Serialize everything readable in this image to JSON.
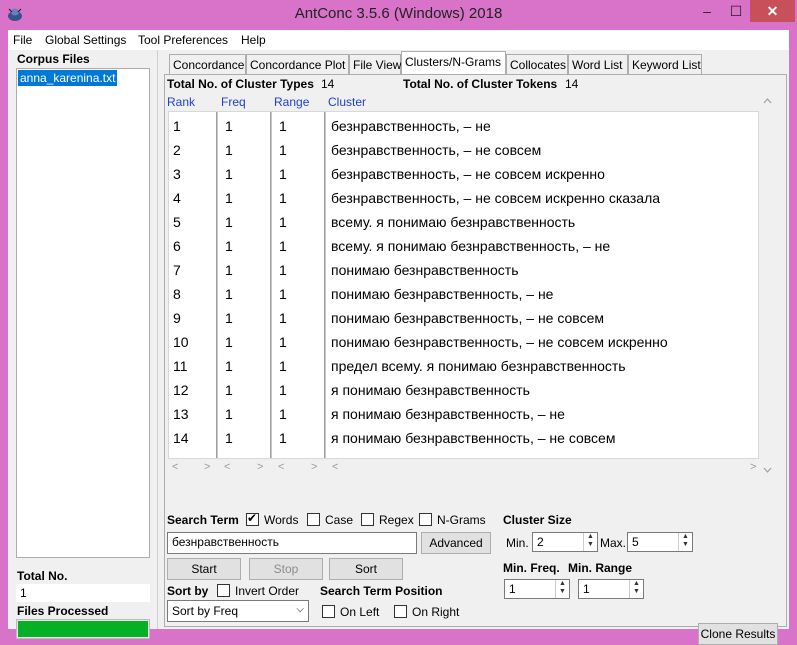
{
  "window": {
    "title": "AntConc 3.5.6 (Windows) 2018",
    "min": "–",
    "max": "☐",
    "close": "✕"
  },
  "menu": [
    "File",
    "Global Settings",
    "Tool Preferences",
    "Help"
  ],
  "left": {
    "corpus_files_label": "Corpus Files",
    "corpus_file": "anna_karenina.txt",
    "total_no_label": "Total No.",
    "total_no_value": "1",
    "files_processed_label": "Files Processed",
    "progress": 1.0
  },
  "tabs": [
    "Concordance",
    "Concordance Plot",
    "File View",
    "Clusters/N-Grams",
    "Collocates",
    "Word List",
    "Keyword List"
  ],
  "active_tab": "Clusters/N-Grams",
  "stats": {
    "types_label": "Total No. of Cluster Types",
    "types_value": "14",
    "tokens_label": "Total No. of Cluster Tokens",
    "tokens_value": "14"
  },
  "columns": [
    "Rank",
    "Freq",
    "Range",
    "Cluster"
  ],
  "rows": [
    {
      "rank": "1",
      "freq": "1",
      "range": "1",
      "cluster": "безнравственность, – не"
    },
    {
      "rank": "2",
      "freq": "1",
      "range": "1",
      "cluster": "безнравственность, – не совсем"
    },
    {
      "rank": "3",
      "freq": "1",
      "range": "1",
      "cluster": "безнравственность, – не совсем искренно"
    },
    {
      "rank": "4",
      "freq": "1",
      "range": "1",
      "cluster": "безнравственность, – не совсем искренно сказала"
    },
    {
      "rank": "5",
      "freq": "1",
      "range": "1",
      "cluster": "всему. я понимаю безнравственность"
    },
    {
      "rank": "6",
      "freq": "1",
      "range": "1",
      "cluster": "всему. я понимаю безнравственность, – не"
    },
    {
      "rank": "7",
      "freq": "1",
      "range": "1",
      "cluster": "понимаю безнравственность"
    },
    {
      "rank": "8",
      "freq": "1",
      "range": "1",
      "cluster": "понимаю безнравственность, – не"
    },
    {
      "rank": "9",
      "freq": "1",
      "range": "1",
      "cluster": "понимаю безнравственность, – не совсем"
    },
    {
      "rank": "10",
      "freq": "1",
      "range": "1",
      "cluster": "понимаю безнравственность, – не совсем искренно"
    },
    {
      "rank": "11",
      "freq": "1",
      "range": "1",
      "cluster": "предел всему. я понимаю безнравственность"
    },
    {
      "rank": "12",
      "freq": "1",
      "range": "1",
      "cluster": "я понимаю безнравственность"
    },
    {
      "rank": "13",
      "freq": "1",
      "range": "1",
      "cluster": "я понимаю безнравственность, – не"
    },
    {
      "rank": "14",
      "freq": "1",
      "range": "1",
      "cluster": "я понимаю безнравственность, – не совсем"
    }
  ],
  "search": {
    "label": "Search Term",
    "words_label": "Words",
    "words_checked": true,
    "case_label": "Case",
    "case_checked": false,
    "regex_label": "Regex",
    "regex_checked": false,
    "ngrams_label": "N-Grams",
    "ngrams_checked": false,
    "term": "безнравственность",
    "advanced_label": "Advanced",
    "start_label": "Start",
    "stop_label": "Stop",
    "sort_label": "Sort"
  },
  "sort": {
    "sort_by_label": "Sort by",
    "invert_label": "Invert Order",
    "selected": "Sort by Freq",
    "position_label": "Search Term Position",
    "on_left_label": "On Left",
    "on_right_label": "On Right"
  },
  "cluster_size": {
    "label": "Cluster Size",
    "min_label": "Min.",
    "min_value": "2",
    "max_label": "Max.",
    "max_value": "5",
    "min_freq_label": "Min. Freq.",
    "min_freq_value": "1",
    "min_range_label": "Min. Range",
    "min_range_value": "1"
  },
  "clone_label": "Clone Results"
}
